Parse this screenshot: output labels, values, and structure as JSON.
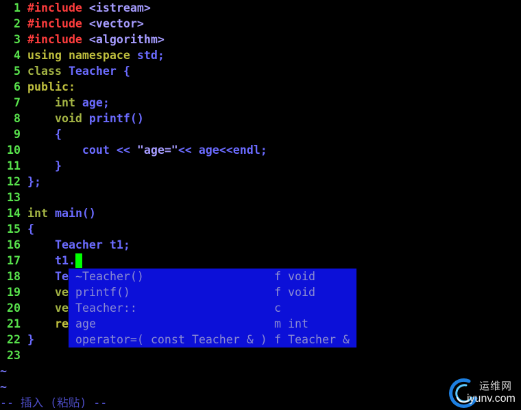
{
  "editor": {
    "lines": [
      {
        "number": "1",
        "code": [
          "#include",
          " <istream>"
        ]
      },
      {
        "number": "2",
        "code": [
          "#include",
          " <vector>"
        ]
      },
      {
        "number": "3",
        "code": [
          "#include",
          " <algorithm>"
        ]
      },
      {
        "number": "4",
        "code": [
          "using",
          " namespace",
          " std;"
        ]
      },
      {
        "number": "5",
        "code": [
          "class",
          " Teacher {"
        ]
      },
      {
        "number": "6",
        "code": [
          "public:"
        ]
      },
      {
        "number": "7",
        "code": [
          "    int",
          " age;"
        ]
      },
      {
        "number": "8",
        "code": [
          "    void",
          " printf()"
        ]
      },
      {
        "number": "9",
        "code": [
          "    {"
        ]
      },
      {
        "number": "10",
        "code": [
          "        cout << ",
          "\"age=\"",
          "<< age<<endl;"
        ]
      },
      {
        "number": "11",
        "code": [
          "    }"
        ]
      },
      {
        "number": "12",
        "code": [
          "};"
        ]
      },
      {
        "number": "13",
        "code": []
      },
      {
        "number": "14",
        "code": [
          "int",
          " main()"
        ]
      },
      {
        "number": "15",
        "code": [
          "{"
        ]
      },
      {
        "number": "16",
        "code": [
          "    Teacher t1;"
        ]
      },
      {
        "number": "17",
        "code": [
          "    t1."
        ]
      },
      {
        "number": "18",
        "code": [
          "    Te"
        ]
      },
      {
        "number": "19",
        "code": [
          "    ve"
        ]
      },
      {
        "number": "20",
        "code": [
          "    ve"
        ]
      },
      {
        "number": "21",
        "code": [
          "    re"
        ]
      },
      {
        "number": "22",
        "code": [
          "}"
        ]
      },
      {
        "number": "23",
        "code": []
      }
    ],
    "filler_rows": [
      "~",
      "~"
    ],
    "mode_message": "-- 插入 (粘贴) --"
  },
  "completion_popup": {
    "items": [
      {
        "word": "~Teacher()",
        "kind": "f",
        "menu": "void"
      },
      {
        "word": "printf()",
        "kind": "f",
        "menu": "void"
      },
      {
        "word": "Teacher::",
        "kind": "c"
      },
      {
        "word": "age",
        "kind": "m",
        "menu": "int"
      },
      {
        "word": "operator=( const Teacher & )",
        "kind": "f",
        "menu": "Teacher &"
      }
    ]
  },
  "watermark": {
    "logo_icon": "swirl-logo-icon",
    "site_name": "运维网",
    "domain": "iyunv.com"
  },
  "colors": {
    "background": "#000000",
    "line_number": "#58e24c",
    "preproc": "#ff3d3d",
    "include_string": "#a69cff",
    "statement": "#bfbf3e",
    "type": "#a4b444",
    "identifier": "#6b6bff",
    "cursor": "#00ff00",
    "popup_bg": "#0c10d8",
    "popup_text": "#8b8bd2",
    "nontext": "#7878ff",
    "mode_message": "#4c4cc4",
    "watermark_name": "#d6d6d6",
    "watermark_domain": "#f0f0f0",
    "logo_outer": "#1d7fe0",
    "logo_inner": "#5cc8ff"
  }
}
